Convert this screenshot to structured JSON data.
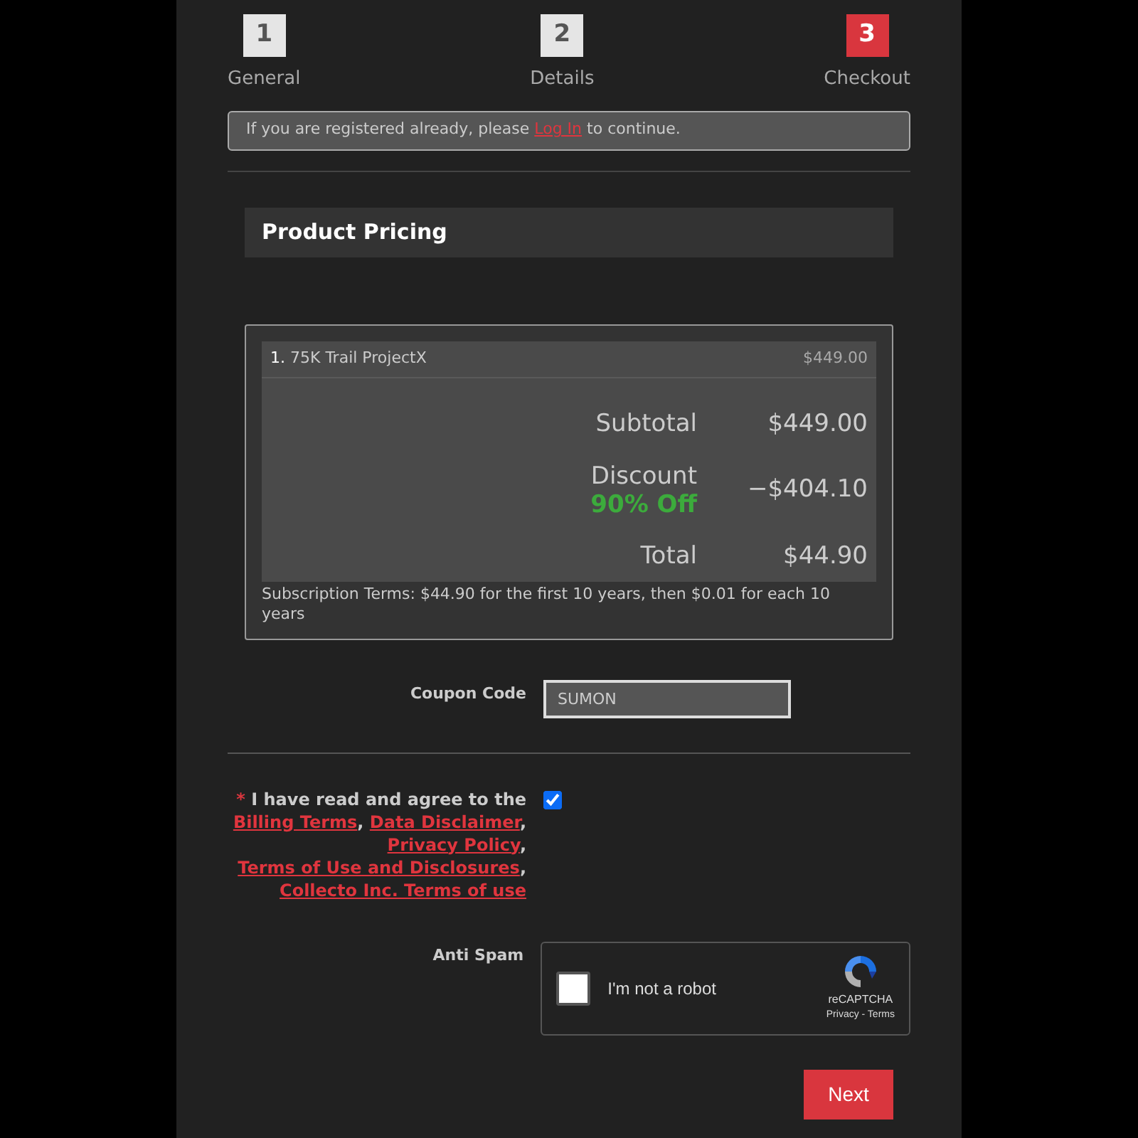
{
  "steps": [
    {
      "number": "1",
      "label": "General",
      "selected": false
    },
    {
      "number": "2",
      "label": "Details",
      "selected": false
    },
    {
      "number": "3",
      "label": "Checkout",
      "selected": true
    }
  ],
  "login_notice": {
    "before": "If you are registered already, please",
    "link": "Log In",
    "after": "to continue."
  },
  "section_title": "Product Pricing",
  "order": {
    "items": [
      {
        "index": "1.",
        "name": "75K Trail ProjectX",
        "price": "$449.00"
      }
    ],
    "subtotal_label": "Subtotal",
    "subtotal": "$449.00",
    "discount_label": "Discount",
    "discount_badge": "90% Off",
    "discount": "−$404.10",
    "total_label": "Total",
    "total": "$44.90",
    "terms": "Subscription Terms: $44.90 for the first 10 years, then $0.01 for each 10 years"
  },
  "coupon": {
    "label": "Coupon Code",
    "value": "SUMON"
  },
  "agreement": {
    "asterisk": "*",
    "checked": true,
    "parts": [
      {
        "kind": "text",
        "text": "I have read and agree to the "
      },
      {
        "kind": "link",
        "text": "Billing Terms"
      },
      {
        "kind": "text",
        "text": ", "
      },
      {
        "kind": "link",
        "text": "Data Disclaimer"
      },
      {
        "kind": "text",
        "text": ", "
      },
      {
        "kind": "link",
        "text": "Privacy Policy"
      },
      {
        "kind": "text",
        "text": ", "
      },
      {
        "kind": "link",
        "text": "Terms of Use and Disclosures"
      },
      {
        "kind": "text",
        "text": ", "
      },
      {
        "kind": "link",
        "text": "Collecto Inc. Terms of use"
      }
    ]
  },
  "captcha": {
    "label": "Anti Spam",
    "checkbox_label": "I'm not a robot",
    "checked": false,
    "brand": "reCAPTCHA",
    "links": "Privacy - Terms"
  },
  "next_button": "Next"
}
